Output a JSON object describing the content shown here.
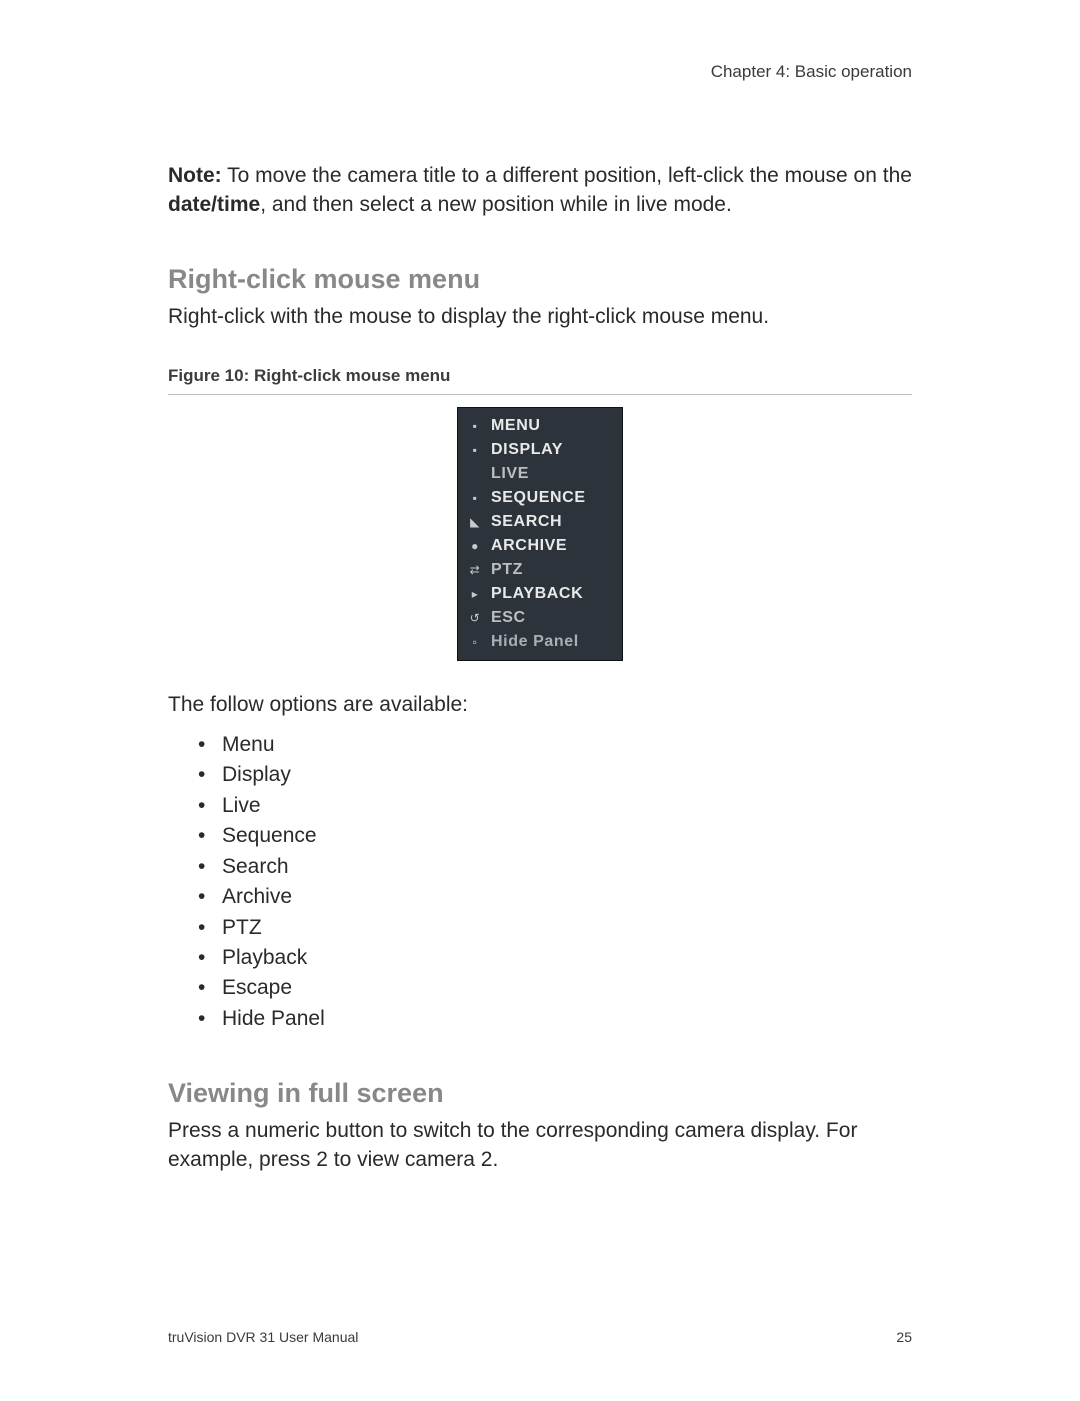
{
  "header": {
    "chapter": "Chapter 4: Basic operation"
  },
  "note": {
    "bold_prefix": "Note:",
    "text_1": " To move the camera title to a different position, left-click the mouse on the ",
    "bold_inline": "date/time",
    "text_2": ", and then select a new position while in live mode."
  },
  "section_right_click": {
    "title": "Right-click mouse menu",
    "intro": "Right-click with the mouse to display the right-click mouse menu.",
    "figure_caption": "Figure 10: Right-click mouse menu",
    "menu_items": [
      {
        "icon": "menu-icon",
        "glyph": "▪",
        "label": "MENU"
      },
      {
        "icon": "display-icon",
        "glyph": "▪",
        "label": "DISPLAY"
      },
      {
        "icon": "live-icon",
        "glyph": " ",
        "label": "LIVE"
      },
      {
        "icon": "sequence-icon",
        "glyph": "▪",
        "label": "SEQUENCE"
      },
      {
        "icon": "search-icon",
        "glyph": "◣",
        "label": "SEARCH"
      },
      {
        "icon": "archive-icon",
        "glyph": "●",
        "label": "ARCHIVE"
      },
      {
        "icon": "ptz-icon",
        "glyph": "⇄",
        "label": "PTZ"
      },
      {
        "icon": "playback-icon",
        "glyph": "▸",
        "label": "PLAYBACK"
      },
      {
        "icon": "esc-icon",
        "glyph": "↺",
        "label": "ESC"
      },
      {
        "icon": "hidepanel-icon",
        "glyph": "▫",
        "label": "Hide Panel"
      }
    ],
    "options_intro": "The follow options are available:",
    "options": [
      "Menu",
      "Display",
      "Live",
      "Sequence",
      "Search",
      "Archive",
      "PTZ",
      "Playback",
      "Escape",
      "Hide Panel"
    ]
  },
  "section_fullscreen": {
    "title": "Viewing in full screen",
    "text": "Press a numeric button to switch to the corresponding camera display. For example, press 2 to view camera 2."
  },
  "footer": {
    "manual": "truVision DVR 31 User Manual",
    "page": "25"
  }
}
